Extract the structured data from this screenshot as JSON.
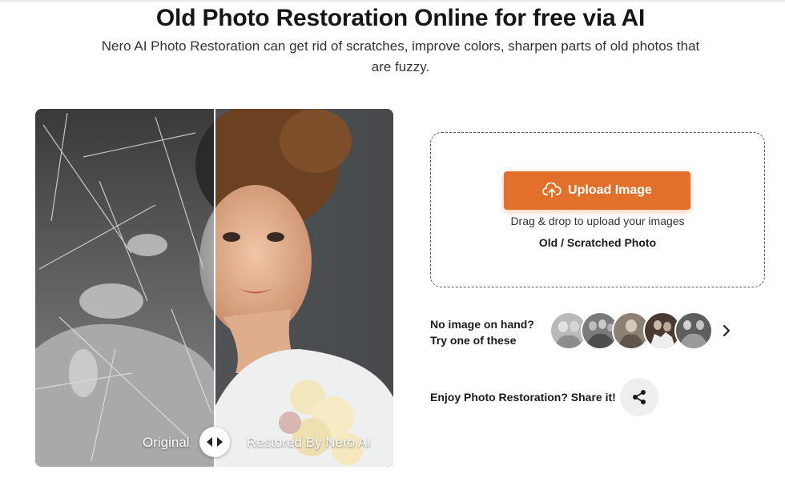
{
  "header": {
    "title": "Old Photo Restoration Online for free via AI",
    "subtitle": "Nero AI Photo Restoration can get rid of scratches, improve colors, sharpen parts of old photos that are fuzzy."
  },
  "comparison": {
    "original_label": "Original",
    "restored_label": "Restored By Nero AI",
    "handle_icon": "left-right-arrows-icon"
  },
  "upload": {
    "button_label": "Upload Image",
    "button_icon": "cloud-upload-icon",
    "drag_text": "Drag & drop to upload your images",
    "photo_type": "Old / Scratched Photo",
    "accent_color": "#e2702b"
  },
  "samples": {
    "prompt_line1": "No image on hand?",
    "prompt_line2": "Try one of these",
    "next_icon": "chevron-right-icon",
    "count": 5
  },
  "share": {
    "text": "Enjoy Photo Restoration? Share it!",
    "icon": "share-icon"
  }
}
